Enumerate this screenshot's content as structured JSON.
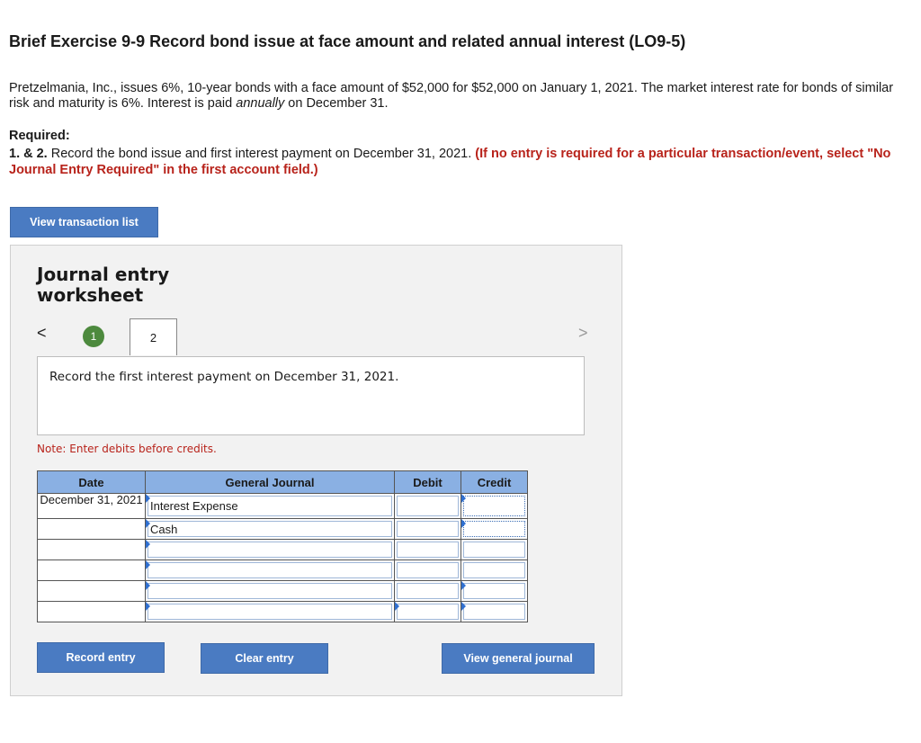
{
  "title": "Brief Exercise 9-9 Record bond issue at face amount and related annual interest (LO9-5)",
  "intro": {
    "before_italic": "Pretzelmania, Inc., issues 6%, 10-year bonds with a face amount of $52,000 for $52,000 on January 1, 2021. The market interest rate for bonds of similar risk and maturity is 6%. Interest is paid ",
    "italic": "annually",
    "after_italic": " on December 31."
  },
  "required": {
    "heading": "Required:",
    "number": "1. & 2.",
    "text": " Record the bond issue and first interest payment on December 31, 2021. ",
    "red_note": "(If no entry is required for a particular transaction/event, select \"No Journal Entry Required\" in the first account field.)"
  },
  "buttons": {
    "view_transaction_list": "View transaction list",
    "record_entry": "Record entry",
    "clear_entry": "Clear entry",
    "view_general_journal": "View general journal"
  },
  "worksheet": {
    "title": "Journal entry worksheet",
    "nav_prev": "<",
    "nav_next": ">",
    "steps": [
      "1",
      "2"
    ],
    "active_step": 2,
    "prompt": "Record the first interest payment on December 31, 2021.",
    "note": "Note: Enter debits before credits."
  },
  "journal": {
    "headers": {
      "date": "Date",
      "account": "General Journal",
      "debit": "Debit",
      "credit": "Credit"
    },
    "date": "December 31, 2021",
    "rows": [
      {
        "account": "Interest Expense",
        "debit": "",
        "credit": ""
      },
      {
        "account": "Cash",
        "debit": "",
        "credit": ""
      },
      {
        "account": "",
        "debit": "",
        "credit": ""
      },
      {
        "account": "",
        "debit": "",
        "credit": ""
      },
      {
        "account": "",
        "debit": "",
        "credit": ""
      },
      {
        "account": "",
        "debit": "",
        "credit": ""
      }
    ]
  },
  "colors": {
    "button": "#4a7bc2",
    "header_blue": "#8ab0e3",
    "red_text": "#b8231b",
    "step_green": "#4d8a3e"
  }
}
